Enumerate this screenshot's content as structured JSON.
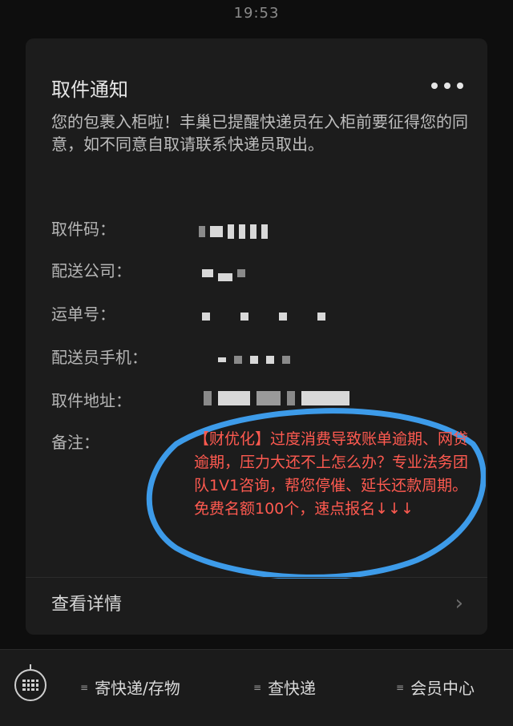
{
  "status_bar": {
    "time": "19:53"
  },
  "card": {
    "title": "取件通知",
    "description": "您的包裹入柜啦！丰巢已提醒快递员在入柜前要征得您的同意，如不同意自取请联系快递员取出。",
    "fields": [
      {
        "label": "取件码："
      },
      {
        "label": "配送公司："
      },
      {
        "label": "运单号："
      },
      {
        "label": "配送员手机："
      },
      {
        "label": "取件地址："
      },
      {
        "label": "备注："
      }
    ],
    "remark": "【财优化】过度消费导致账单逾期、网贷逾期，压力大还不上怎么办？专业法务团队1V1咨询，帮您停催、延长还款周期。免费名额100个，速点报名↓↓↓",
    "detail_label": "查看详情"
  },
  "bottom_menu": {
    "items": [
      "寄快递/存物",
      "查快递",
      "会员中心"
    ]
  },
  "colors": {
    "background": "#0e0e0e",
    "card": "#1c1c1c",
    "remark_text": "#ff5a50",
    "annotation_circle": "#3d9be9"
  }
}
